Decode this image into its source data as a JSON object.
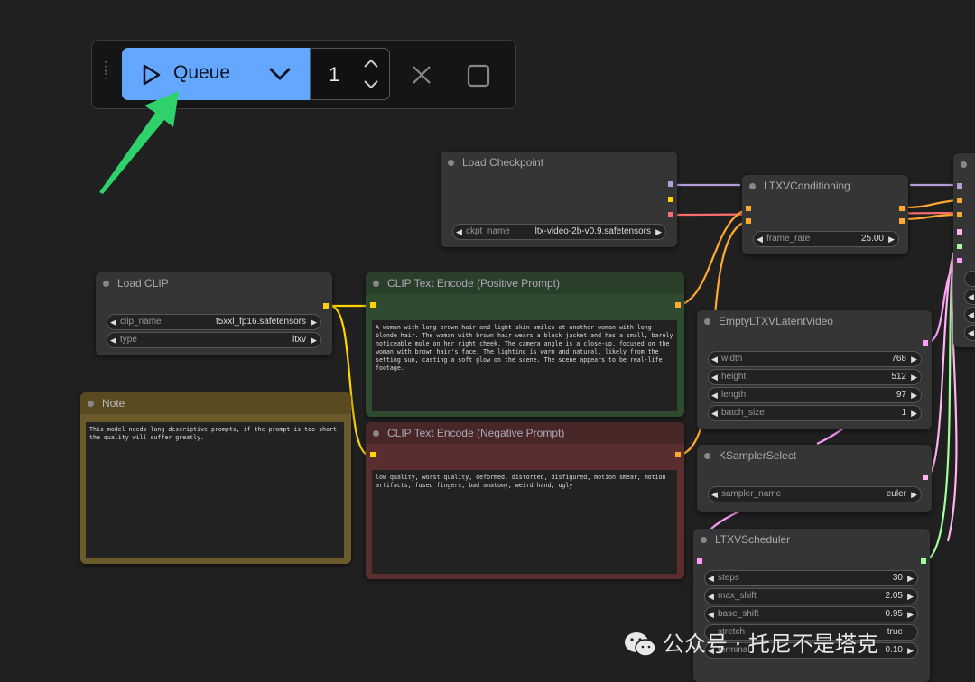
{
  "toolbar": {
    "queue_label": "Queue",
    "batch_count": "1"
  },
  "nodes": {
    "load_checkpoint": {
      "title": "Load Checkpoint",
      "widgets": [
        {
          "name": "ckpt_name",
          "value": "ltx-video-2b-v0.9.safetensors"
        }
      ]
    },
    "ltxv_conditioning": {
      "title": "LTXVConditioning",
      "widgets": [
        {
          "name": "frame_rate",
          "value": "25.00"
        }
      ]
    },
    "load_clip": {
      "title": "Load CLIP",
      "widgets": [
        {
          "name": "clip_name",
          "value": "t5xxl_fp16.safetensors"
        },
        {
          "name": "type",
          "value": "ltxv"
        }
      ]
    },
    "clip_positive": {
      "title": "CLIP Text Encode (Positive Prompt)",
      "text": "A woman with long brown hair and light skin smiles at another woman with long blonde hair. The woman with brown hair wears a black jacket and has a small, barely noticeable mole on her right cheek. The camera angle is a close-up, focused on the woman with brown hair's face. The lighting is warm and natural, likely from the setting sun, casting a soft glow on the scene. The scene appears to be real-life footage."
    },
    "clip_negative": {
      "title": "CLIP Text Encode (Negative Prompt)",
      "text": "low quality, worst quality, deformed, distorted, disfigured, motion smear, motion artifacts, fused fingers, bad anatomy, weird hand, ugly"
    },
    "note": {
      "title": "Note",
      "text": "This model needs long descriptive prompts, if the prompt is too short the quality will suffer greatly."
    },
    "empty_latent": {
      "title": "EmptyLTXVLatentVideo",
      "widgets": [
        {
          "name": "width",
          "value": "768"
        },
        {
          "name": "height",
          "value": "512"
        },
        {
          "name": "length",
          "value": "97"
        },
        {
          "name": "batch_size",
          "value": "1"
        }
      ]
    },
    "ksampler_select": {
      "title": "KSamplerSelect",
      "widgets": [
        {
          "name": "sampler_name",
          "value": "euler"
        }
      ]
    },
    "ltxv_scheduler": {
      "title": "LTXVScheduler",
      "widgets": [
        {
          "name": "steps",
          "value": "30"
        },
        {
          "name": "max_shift",
          "value": "2.05"
        },
        {
          "name": "base_shift",
          "value": "0.95"
        },
        {
          "name": "stretch",
          "value": "true"
        },
        {
          "name": "terminal",
          "value": "0.10"
        }
      ]
    }
  },
  "watermark": {
    "text": "公众号 · 托尼不是塔克"
  },
  "colors": {
    "accent": "#63a7ff",
    "arrow": "#2fd16a",
    "wire_clip": "#ffd400",
    "wire_conditioning": "#ffa931",
    "wire_model": "#b39ddb",
    "wire_vae": "#ff6e6e",
    "wire_latent": "#ff9cf9",
    "wire_sigmas": "#a0ff9c"
  }
}
